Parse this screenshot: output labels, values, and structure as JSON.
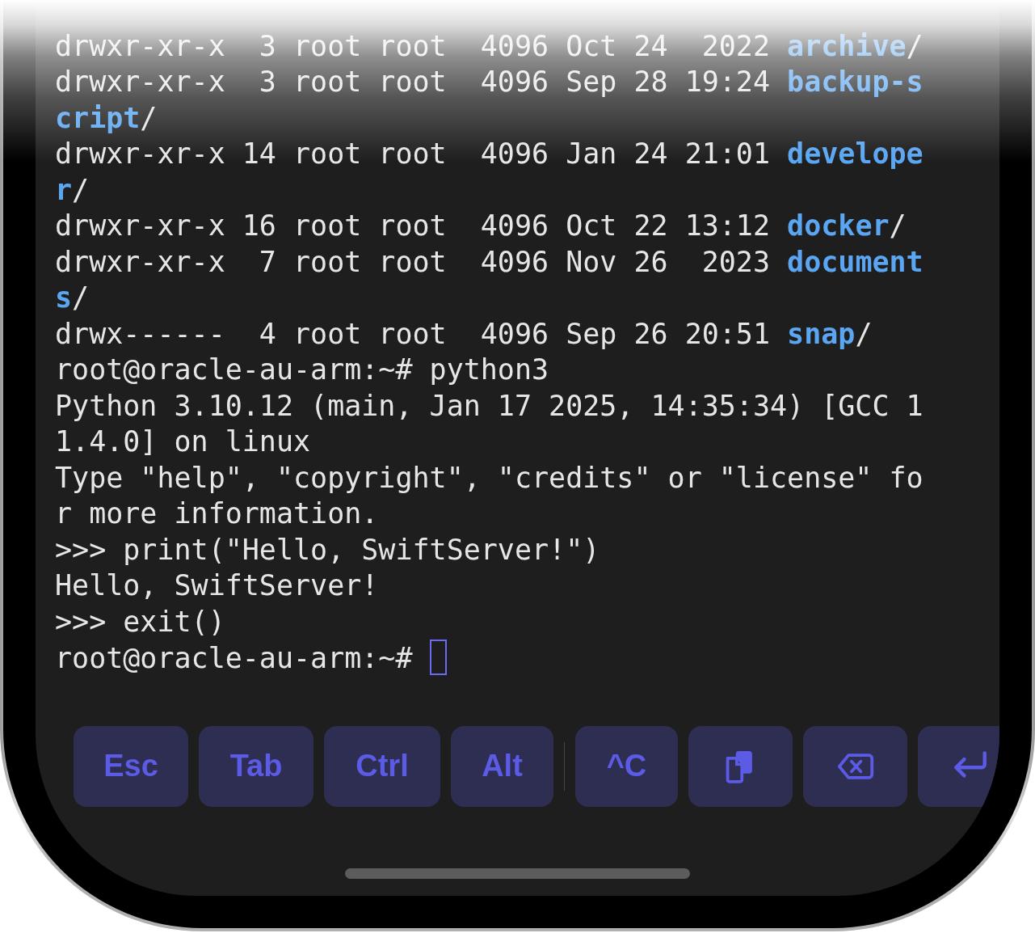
{
  "terminal": {
    "lines": [
      [
        {
          "kind": "text",
          "text": "drwxr-xr-x  3 root root  4096 Oct 24  2022 "
        },
        {
          "kind": "dir",
          "text": "archive"
        },
        {
          "kind": "text",
          "text": "/"
        }
      ],
      [
        {
          "kind": "text",
          "text": "drwxr-xr-x  3 root root  4096 Sep 28 19:24 "
        },
        {
          "kind": "dir",
          "text": "backup-script"
        },
        {
          "kind": "text",
          "text": "/"
        }
      ],
      [
        {
          "kind": "text",
          "text": "drwxr-xr-x 14 root root  4096 Jan 24 21:01 "
        },
        {
          "kind": "dir",
          "text": "developer"
        },
        {
          "kind": "text",
          "text": "/"
        }
      ],
      [
        {
          "kind": "text",
          "text": "drwxr-xr-x 16 root root  4096 Oct 22 13:12 "
        },
        {
          "kind": "dir",
          "text": "docker"
        },
        {
          "kind": "text",
          "text": "/"
        }
      ],
      [
        {
          "kind": "text",
          "text": "drwxr-xr-x  7 root root  4096 Nov 26  2023 "
        },
        {
          "kind": "dir",
          "text": "documents"
        },
        {
          "kind": "text",
          "text": "/"
        }
      ],
      [
        {
          "kind": "text",
          "text": "drwx------  4 root root  4096 Sep 26 20:51 "
        },
        {
          "kind": "dir",
          "text": "snap"
        },
        {
          "kind": "text",
          "text": "/"
        }
      ],
      [
        {
          "kind": "text",
          "text": "root@oracle-au-arm:~# python3"
        }
      ],
      [
        {
          "kind": "text",
          "text": "Python 3.10.12 (main, Jan 17 2025, 14:35:34) [GCC 11.4.0] on linux"
        }
      ],
      [
        {
          "kind": "text",
          "text": "Type \"help\", \"copyright\", \"credits\" or \"license\" for more information."
        }
      ],
      [
        {
          "kind": "text",
          "text": ">>> print(\"Hello, SwiftServer!\")"
        }
      ],
      [
        {
          "kind": "text",
          "text": "Hello, SwiftServer!"
        }
      ],
      [
        {
          "kind": "text",
          "text": ">>> exit()"
        }
      ],
      [
        {
          "kind": "text",
          "text": "root@oracle-au-arm:~# "
        }
      ]
    ],
    "cursor_visible": true
  },
  "key_groups": [
    [
      {
        "kind": "text",
        "label": "Esc"
      },
      {
        "kind": "text",
        "label": "Tab"
      },
      {
        "kind": "text",
        "label": "Ctrl"
      },
      {
        "kind": "text",
        "label": "Alt"
      }
    ],
    [
      {
        "kind": "text",
        "label": "^C"
      },
      {
        "kind": "copy"
      },
      {
        "kind": "backspace"
      },
      {
        "kind": "enter"
      }
    ]
  ]
}
